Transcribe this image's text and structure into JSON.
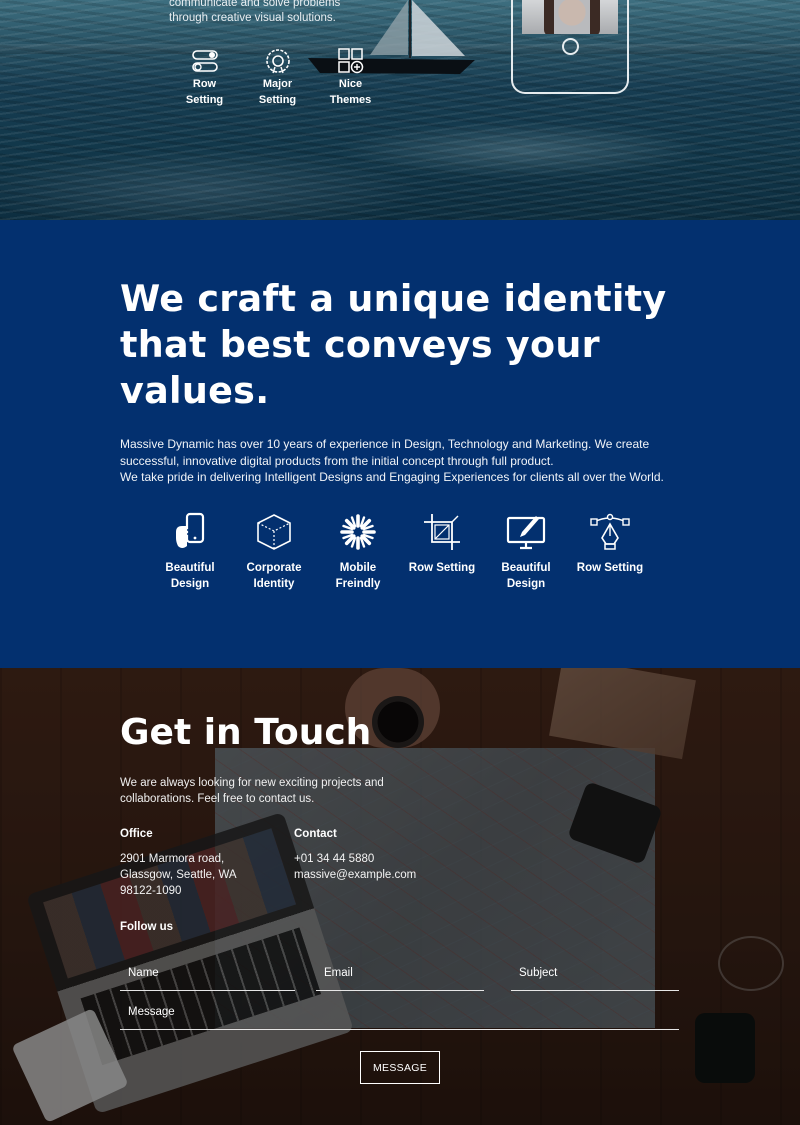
{
  "hero": {
    "copy_line1": "communicate and solve problems",
    "copy_line2": "through creative visual solutions.",
    "features": [
      {
        "icon": "toggle-icon",
        "line1": "Row",
        "line2": "Setting"
      },
      {
        "icon": "badge-icon",
        "line1": "Major",
        "line2": "Setting"
      },
      {
        "icon": "grid-add-icon",
        "line1": "Nice",
        "line2": "Themes"
      }
    ]
  },
  "identity": {
    "heading_line1": "We craft a unique identity",
    "heading_line2": "that best conveys your",
    "heading_line3": "values.",
    "desc_line1": "Massive Dynamic has over 10 years of experience in Design, Technology and Marketing. We create",
    "desc_line2": "successful, innovative digital products from the initial concept through full product.",
    "desc_line3": "We take pride in delivering Intelligent Designs and Engaging Experiences for clients all over the World.",
    "services": [
      {
        "icon": "hand-phone-icon",
        "line1": "Beautiful",
        "line2": "Design"
      },
      {
        "icon": "cube-icon",
        "line1": "Corporate",
        "line2": "Identity"
      },
      {
        "icon": "aperture-icon",
        "line1": "Mobile Freindly",
        "line2": ""
      },
      {
        "icon": "crop-icon",
        "line1": "Row Setting",
        "line2": ""
      },
      {
        "icon": "monitor-pen-icon",
        "line1": "Beautiful",
        "line2": "Design"
      },
      {
        "icon": "pen-tool-icon",
        "line1": "Row Setting",
        "line2": ""
      }
    ],
    "background": "#03306f"
  },
  "contact": {
    "heading": "Get in Touch",
    "intro_line1": "We are always looking for new exciting projects and",
    "intro_line2": "collaborations. Feel free to contact us.",
    "office_label": "Office",
    "office_line1": "2901 Marmora road,",
    "office_line2": "Glassgow, Seattle, WA",
    "office_line3": "98122-1090",
    "contact_label": "Contact",
    "phone": "+01 34 44 5880",
    "email": "massive@example.com",
    "follow_label": "Follow us",
    "form": {
      "name_placeholder": "Name",
      "email_placeholder": "Email",
      "subject_placeholder": "Subject",
      "message_placeholder": "Message",
      "submit_label": "MESSAGE"
    }
  }
}
